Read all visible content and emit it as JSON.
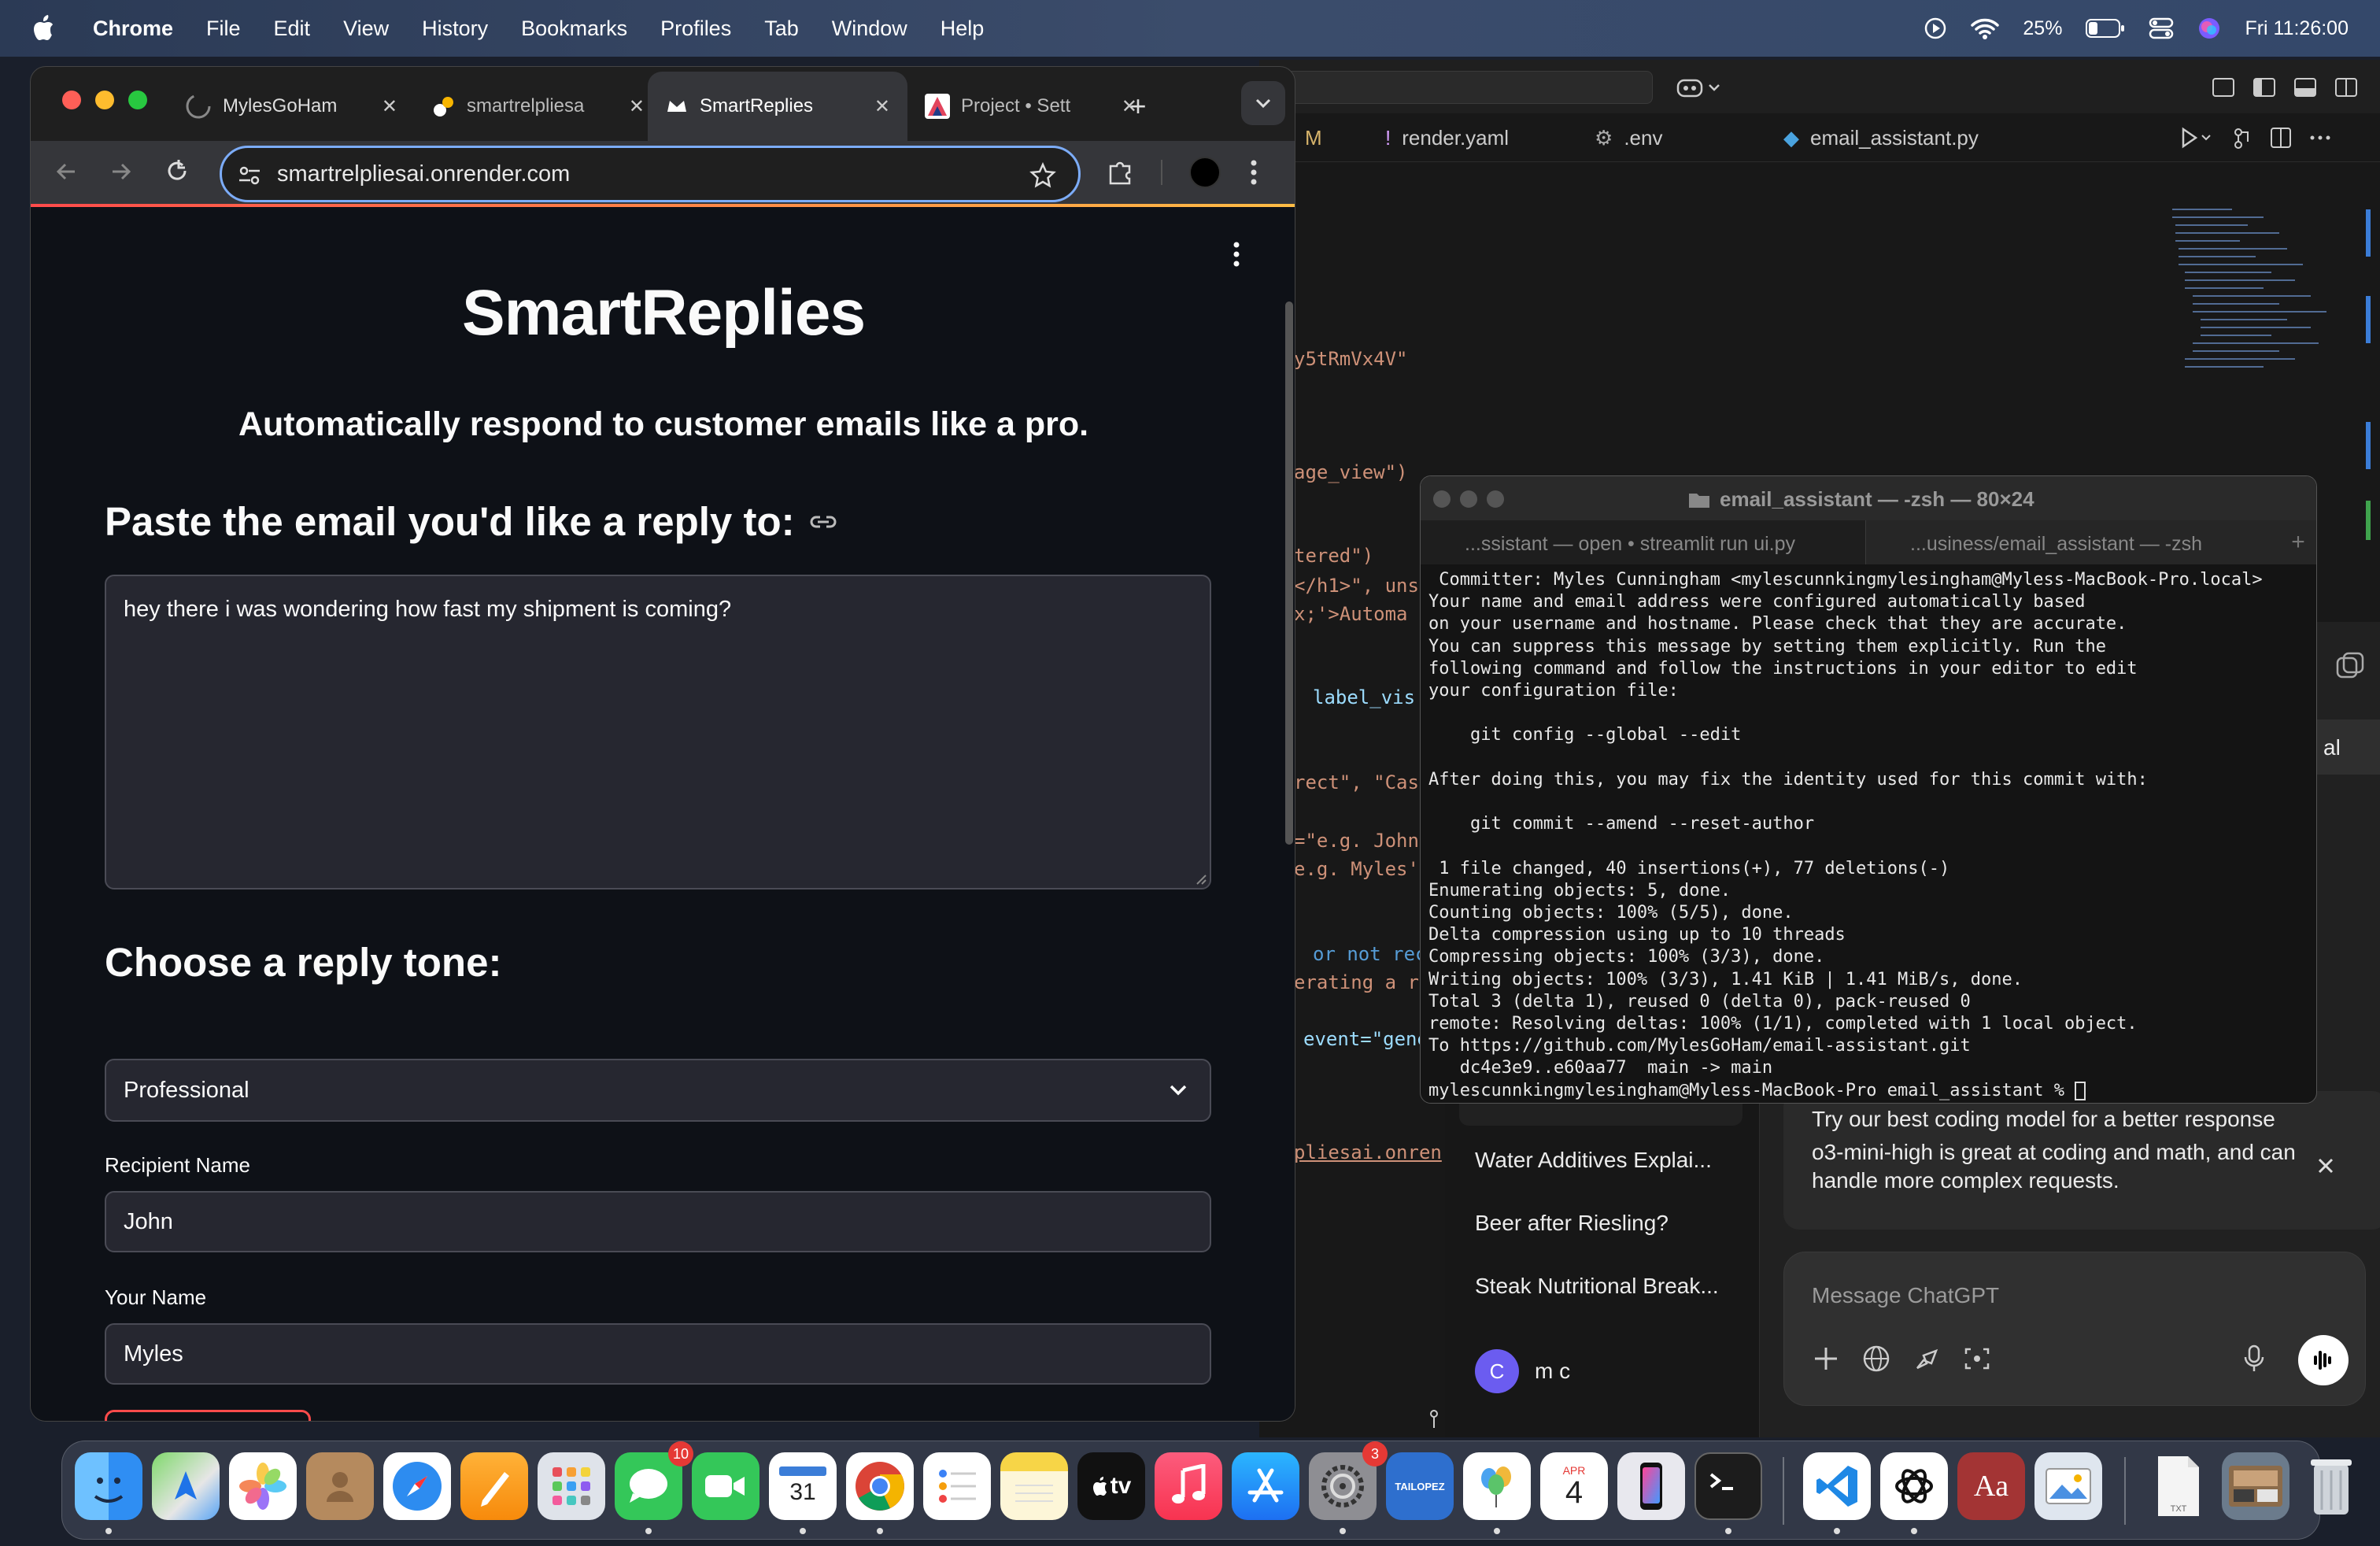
{
  "menubar": {
    "app": "Chrome",
    "items": [
      "File",
      "Edit",
      "View",
      "History",
      "Bookmarks",
      "Profiles",
      "Tab",
      "Window",
      "Help"
    ],
    "battery": "25%",
    "clock": "Fri 11:26:00"
  },
  "chrome": {
    "tabs": [
      {
        "label": "MylesGoHam"
      },
      {
        "label": "smartrelpliesa"
      },
      {
        "label": "SmartReplies"
      },
      {
        "label": "Project • Sett"
      }
    ],
    "url": "smartrelpliesai.onrender.com"
  },
  "app": {
    "title": "SmartReplies",
    "subtitle": "Automatically respond to customer emails like a pro.",
    "email_heading": "Paste the email you'd like a reply to:",
    "email_text": "hey there i was wondering how fast my shipment is coming?",
    "tone_heading": "Choose a reply tone:",
    "tone_value": "Professional",
    "recipient_label": "Recipient Name",
    "recipient_value": "John",
    "your_name_label": "Your Name",
    "your_name_value": "Myles"
  },
  "vscode": {
    "tab_m": "M",
    "tabs": [
      "render.yaml",
      ".env",
      "email_assistant.py"
    ],
    "code_lines": [
      "y5tRmVx4V\"",
      "age_view\")",
      "tered\")",
      "</h1>\", uns",
      "x;'>Automa",
      "label_vis",
      "rect\", \"Casu",
      "=\"e.g. John",
      "e.g. Myles'",
      "or not rec",
      "erating a r",
      "event=\"gene",
      "pliesai.onren"
    ]
  },
  "terminal": {
    "title": "email_assistant — -zsh — 80×24",
    "tabs": [
      "...ssistant — open • streamlit run ui.py",
      "...usiness/email_assistant — -zsh"
    ],
    "lines": [
      " Committer: Myles Cunningham <mylescunnkingmylesingham@Myless-MacBook-Pro.local>",
      "Your name and email address were configured automatically based",
      "on your username and hostname. Please check that they are accurate.",
      "You can suppress this message by setting them explicitly. Run the",
      "following command and follow the instructions in your editor to edit",
      "your configuration file:",
      "",
      "    git config --global --edit",
      "",
      "After doing this, you may fix the identity used for this commit with:",
      "",
      "    git commit --amend --reset-author",
      "",
      " 1 file changed, 40 insertions(+), 77 deletions(-)",
      "Enumerating objects: 5, done.",
      "Counting objects: 100% (5/5), done.",
      "Delta compression using up to 10 threads",
      "Compressing objects: 100% (3/3), done.",
      "Writing objects: 100% (3/3), 1.41 KiB | 1.41 MiB/s, done.",
      "Total 3 (delta 1), reused 0 (delta 0), pack-reused 0",
      "remote: Resolving deltas: 100% (1/1), completed with 1 local object.",
      "To https://github.com/MylesGoHam/email-assistant.git",
      "   dc4e3e9..e60aa77  main -> main",
      "mylescunnkingmylesingham@Myless-MacBook-Pro email_assistant % "
    ]
  },
  "chatgpt": {
    "history": [
      "Water Additives Explai...",
      "Beer after Riesling?",
      "Steak Nutritional Break..."
    ],
    "user_initial": "C",
    "user_name": "m c",
    "promo_title": "Try our best coding model for a better response",
    "promo_body": "o3-mini-high is great at coding and math, and can handle more complex requests.",
    "message_placeholder": "Message ChatGPT",
    "partial_label": "al"
  },
  "dock": {
    "messages_badge": "10",
    "settings_badge": "3",
    "calendar_day": "31",
    "reminders_month": "APR",
    "reminders_day": "4",
    "tv_label": "tv",
    "dictionary_label": "Aa",
    "tailopez_label": "TAILOPEZ",
    "txt_label": "TXT"
  }
}
